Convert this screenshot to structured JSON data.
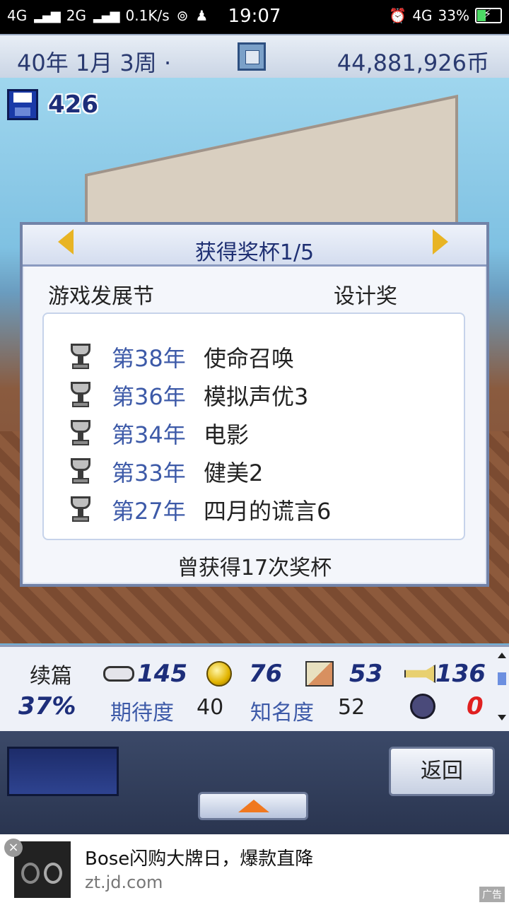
{
  "status_bar": {
    "network1": "4G",
    "network2": "2G",
    "speed": "0.1K/s",
    "time": "19:07",
    "network3": "4G",
    "battery": "33%"
  },
  "top_bar": {
    "date": "40年 1月 3周 ·",
    "money": "44,881,926币"
  },
  "save": {
    "count": "426"
  },
  "dialog": {
    "title": "获得奖杯1/5",
    "category": "游戏发展节",
    "award_type": "设计奖",
    "awards": [
      {
        "year": "第38年",
        "name": "使命召唤"
      },
      {
        "year": "第36年",
        "name": "模拟声优3"
      },
      {
        "year": "第34年",
        "name": "电影"
      },
      {
        "year": "第33年",
        "name": "健美2"
      },
      {
        "year": "第27年",
        "name": "四月的谎言6"
      }
    ],
    "total": "曾获得17次奖杯"
  },
  "info": {
    "sequel_label": "续篇",
    "sequel_pct": "37%",
    "stat_fun": "145",
    "stat_creativity": "76",
    "stat_graphics": "53",
    "stat_sound": "136",
    "expectation_label": "期待度",
    "expectation_value": "40",
    "fame_label": "知名度",
    "fame_value": "52",
    "bugs": "0"
  },
  "controls": {
    "back_label": "返回"
  },
  "ad": {
    "title": "Bose闪购大牌日，爆款直降",
    "url": "zt.jd.com",
    "tag": "广告"
  },
  "colors": {
    "accent_blue": "#3d5aa8",
    "dark_blue": "#1d2e7a",
    "gold_arrow": "#e8b424",
    "bug_red": "#e02020"
  }
}
